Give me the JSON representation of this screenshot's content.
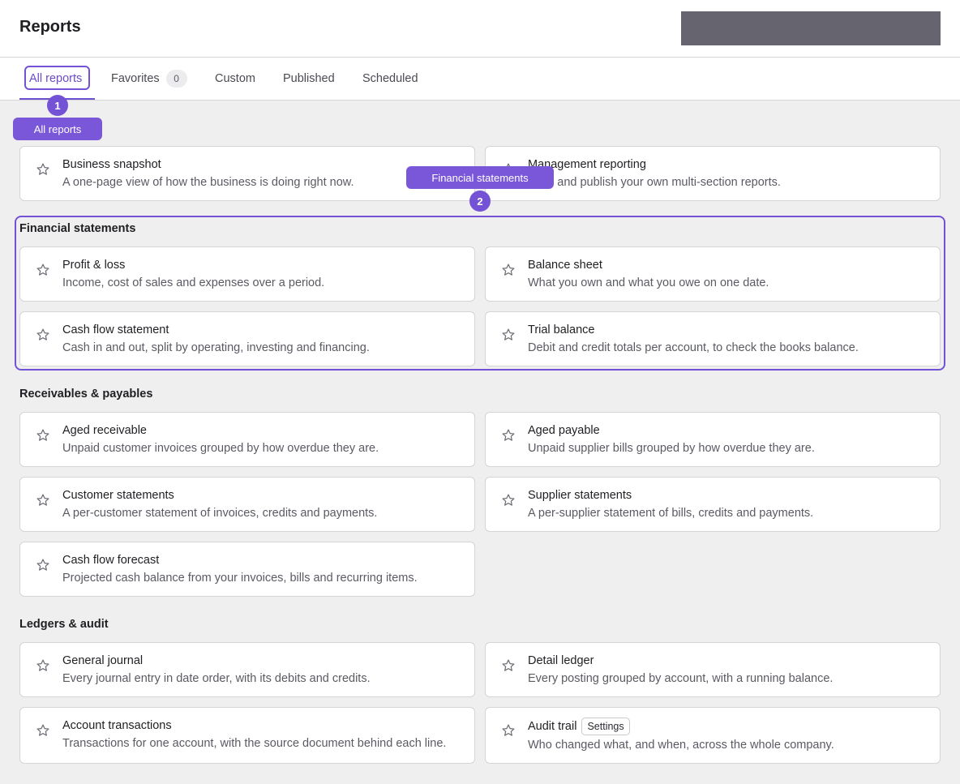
{
  "header": {
    "title": "Reports"
  },
  "tabs": [
    {
      "label": "All reports"
    },
    {
      "label": "Favorites",
      "count": "0"
    },
    {
      "label": "Custom"
    },
    {
      "label": "Published"
    },
    {
      "label": "Scheduled"
    }
  ],
  "annotations": {
    "marker_1": "1",
    "marker_2": "2",
    "callout_1": "All reports",
    "callout_2": "Financial statements"
  },
  "top_cards": [
    {
      "name": "Business snapshot",
      "desc": "A one-page view of how the business is doing right now."
    },
    {
      "name": "Management reporting",
      "desc": "Build and publish your own multi-section reports."
    }
  ],
  "sections": [
    {
      "title": "Financial statements",
      "cards": [
        {
          "name": "Profit & loss",
          "desc": "Income, cost of sales and expenses over a period."
        },
        {
          "name": "Balance sheet",
          "desc": "What you own and what you owe on one date."
        },
        {
          "name": "Cash flow statement",
          "desc": "Cash in and out, split by operating, investing and financing."
        },
        {
          "name": "Trial balance",
          "desc": "Debit and credit totals per account, to check the books balance."
        }
      ]
    },
    {
      "title": "Receivables & payables",
      "cards": [
        {
          "name": "Aged receivable",
          "desc": "Unpaid customer invoices grouped by how overdue they are."
        },
        {
          "name": "Aged payable",
          "desc": "Unpaid supplier bills grouped by how overdue they are."
        },
        {
          "name": "Customer statements",
          "desc": "A per-customer statement of invoices, credits and payments."
        },
        {
          "name": "Supplier statements",
          "desc": "A per-supplier statement of bills, credits and payments."
        },
        {
          "name": "Cash flow forecast",
          "desc": "Projected cash balance from your invoices, bills and recurring items."
        }
      ]
    },
    {
      "title": "Ledgers & audit",
      "cards": [
        {
          "name": "General journal",
          "desc": "Every journal entry in date order, with its debits and credits."
        },
        {
          "name": "Detail ledger",
          "desc": "Every posting grouped by account, with a running balance."
        },
        {
          "name": "Account transactions",
          "desc": "Transactions for one account, with the source document behind each line."
        },
        {
          "name": "Audit trail",
          "desc": "Who changed what, and when, across the whole company.",
          "badge": "Settings"
        }
      ]
    }
  ],
  "icons": {
    "favorite": "star-outline-icon"
  },
  "colors": {
    "accent": "#7452d6",
    "header_block": "#66646f",
    "background": "#efefef"
  }
}
